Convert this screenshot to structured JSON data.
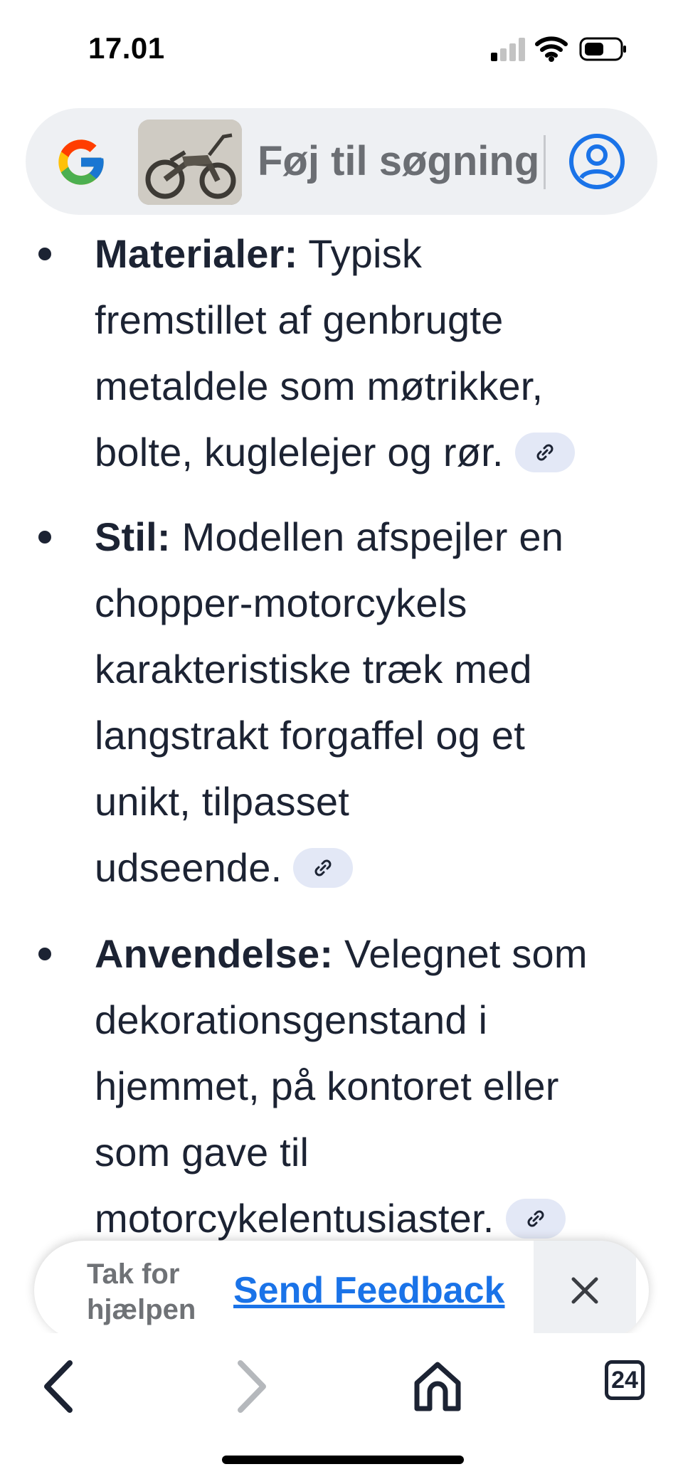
{
  "status_bar": {
    "time": "17.01",
    "signal_icon": "cellular-signal-icon",
    "wifi_icon": "wifi-icon",
    "battery_icon": "battery-icon"
  },
  "search": {
    "logo_icon": "google-logo-icon",
    "thumbnail": "motorcycle-image-thumbnail",
    "placeholder": "Føj til søgning",
    "account_icon": "account-icon"
  },
  "content": {
    "bullets": [
      {
        "term": "Materialer:",
        "lines": [
          "Typisk",
          "fremstillet af genbrugte",
          "metaldele som møtrikker,",
          "bolte, kuglelejer og rør."
        ]
      },
      {
        "term": "Stil:",
        "lines": [
          "Modellen afspejler en",
          "chopper-motorcykels",
          "karakteristiske træk med",
          "langstrakt forgaffel og et",
          "unikt, tilpasset",
          "udseende."
        ]
      },
      {
        "term": "Anvendelse:",
        "lines": [
          "Velegnet som",
          "dekorationsgenstand i",
          "hjemmet, på kontoret eller",
          "som gave til",
          "motorcykelentusiaster."
        ]
      }
    ]
  },
  "feedback": {
    "thanks_line1": "Tak for",
    "thanks_line2": "hjælpen",
    "send_label": "Send Feedback",
    "close_icon": "close-icon"
  },
  "bottom_nav": {
    "back_icon": "chevron-left-icon",
    "forward_icon": "chevron-right-icon",
    "home_icon": "home-icon",
    "tab_count": "24"
  },
  "colors": {
    "text": "#1c2333",
    "link_blue": "#1a73e8",
    "search_bg": "#eef0f3",
    "chip_bg": "#e3e8f6"
  }
}
